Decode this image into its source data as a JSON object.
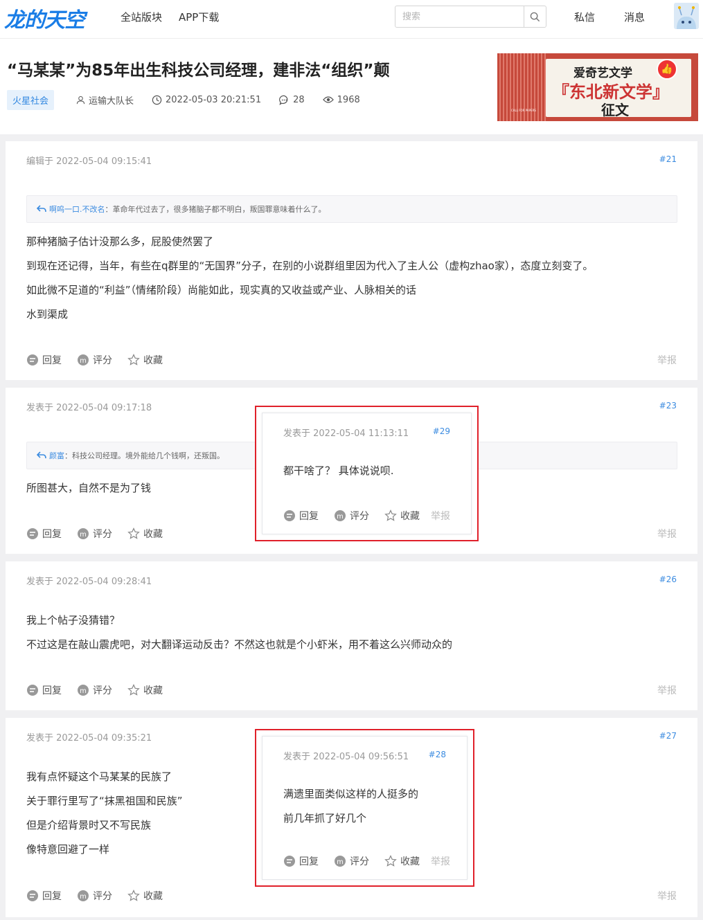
{
  "nav": {
    "logo": "龙的天空",
    "links": [
      "全站版块",
      "APP下载"
    ],
    "search_placeholder": "搜索",
    "messages": "私信",
    "notifications": "消息"
  },
  "header": {
    "title": "“马某某”为85年出生科技公司经理，建非法“组织”颠",
    "tag": "火星社会",
    "author": "运输大队长",
    "datetime": "2022-05-03 20:21:51",
    "comments": "28",
    "views": "1968",
    "banner": {
      "line1": "爱奇艺文学",
      "line2": "『东北新文学』",
      "line3": "征文",
      "small": "CALL FOR PAPERS"
    }
  },
  "actions": {
    "reply": "回复",
    "rate": "评分",
    "favorite": "收藏",
    "report": "举报"
  },
  "posts": [
    {
      "time": "编辑于 2022-05-04 09:15:41",
      "floor": "#21",
      "quote_user": "啊呜一口.不改名",
      "quote_text": "：革命年代过去了，很多猪脑子都不明白，叛国罪意味着什么了。",
      "lines": [
        "那种猪脑子估计没那么多，屁股使然罢了",
        "到现在还记得，当年，有些在q群里的“无国界”分子，在别的小说群组里因为代入了主人公（虚构zhao家），态度立刻变了。",
        "如此微不足道的“利益”（情绪阶段）尚能如此，现实真的又收益或产业、人脉相关的话",
        "水到渠成"
      ]
    },
    {
      "time": "发表于 2022-05-04 09:17:18",
      "floor": "#23",
      "quote_user": "颜富",
      "quote_text": "：科技公司经理。境外能给几个钱啊，还叛国。",
      "lines": [
        "所图甚大，自然不是为了钱"
      ],
      "nested": {
        "time": "发表于 2022-05-04 11:13:11",
        "floor": "#29",
        "lines": [
          "都干啥了？ 具体说说呗."
        ]
      }
    },
    {
      "time": "发表于 2022-05-04 09:28:41",
      "floor": "#26",
      "lines": [
        "我上个帖子没猜错？",
        "不过这是在敲山震虎吧，对大翻译运动反击？不然这也就是个小虾米，用不着这么兴师动众的"
      ]
    },
    {
      "time": "发表于 2022-05-04 09:35:21",
      "floor": "#27",
      "lines": [
        "我有点怀疑这个马某某的民族了",
        "关于罪行里写了“抹黑祖国和民族”",
        "但是介绍背景时又不写民族",
        "像特意回避了一样"
      ],
      "nested": {
        "time": "发表于 2022-05-04 09:56:51",
        "floor": "#28",
        "lines": [
          "满遗里面类似这样的人挺多的",
          "前几年抓了好几个"
        ]
      }
    }
  ]
}
